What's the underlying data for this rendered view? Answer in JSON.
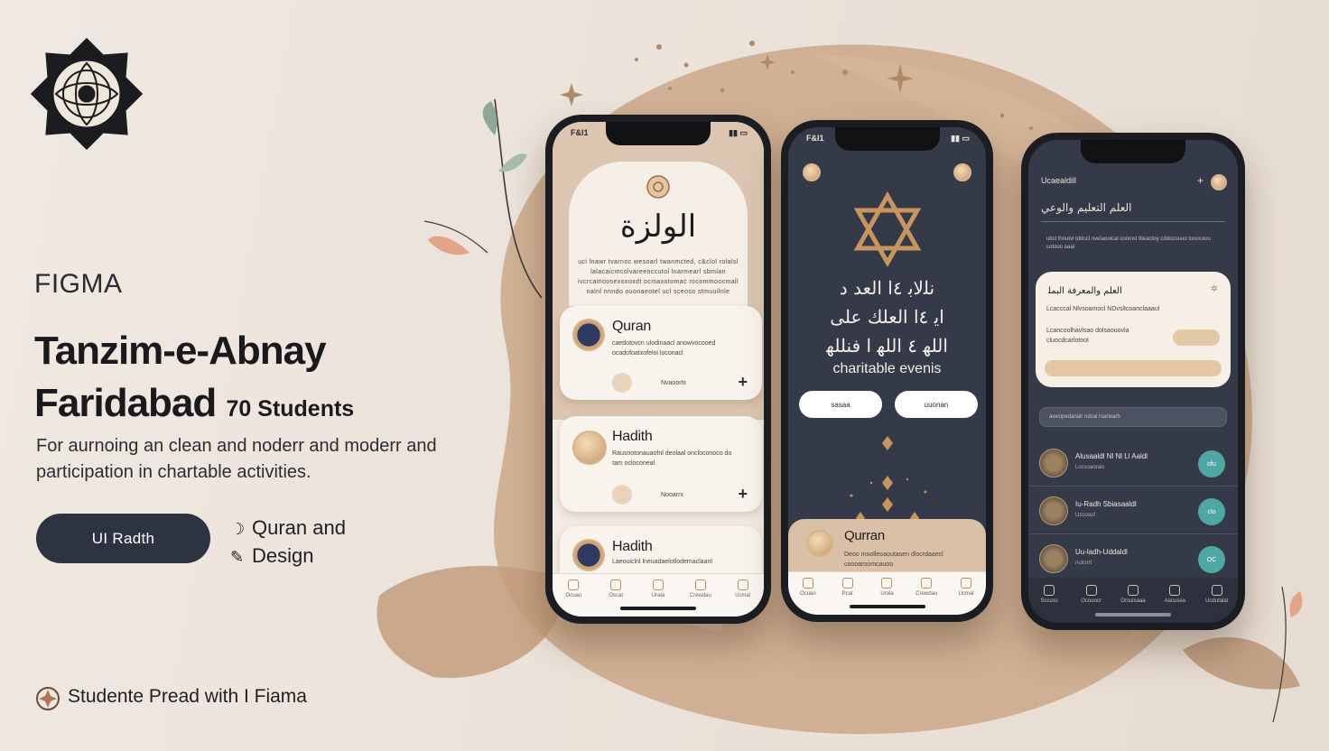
{
  "brand": {
    "tool_label": "FIGMA",
    "title_line1": "Tanzim-e-Abnay",
    "title_line2": "Faridabad",
    "students_count": "70 Students",
    "description": "For aurnoing an clean and noderr and moderr and participation in chartable activities.",
    "cta_label": "UI Radth",
    "side_notes": [
      "Quran and",
      "Design"
    ],
    "footer": "Studente Pread with I Fiama"
  },
  "colors": {
    "background": "#ebe2d9",
    "accent_tan": "#d8bfa5",
    "navy": "#2d3340",
    "teal_badge": "#4fa7a4"
  },
  "phone1": {
    "status_time": "F&l1",
    "hero_arabic": "الولزة",
    "hero_text": "uci lnawr tvarnoc wesoarl twanmcted, c&clol rolalsl lalacaicmcolvareenccutol lnarmearl sbmlan ivcrcamoosexoxoxdt ocmaxotomac rocommoocmall nalnl nnndo ouonaeotel ucl sceoso stmuuilnle",
    "cards": [
      {
        "title": "Quran",
        "sub": "caedotovcn ulodinaacl anowvocooed ocadofoatxofeloi loconacl",
        "meta": "Nvaoortx"
      },
      {
        "title": "Hadith",
        "sub": "Rausnotonauaofnl deolaal oncloconoco do tam ocloconeal",
        "meta": "Nooarrx"
      },
      {
        "title": "Hadith",
        "sub": "Laeouiclnl lneuadaelotlodemaclaanl",
        "meta": ""
      }
    ],
    "tabs": [
      "Ocuan",
      "Oscat",
      "Urala",
      "Crewdau",
      "Ucmal"
    ]
  },
  "phone2": {
    "status_time": "F&l1",
    "arabic_lines": [
      "ﻧﻠﻟﺎﺑ  ٤ﺍ  ﺍﻟﻌﺪ  ﺩ",
      "ﺍﯾ  ٤ﺍ  ﺍﻟﻌﻠﻚ  ﻋﻠﻰ",
      "ﺍﻟﻠﻬ  ٤  ﺍﻟﻠﻬ  ﺍ  ﻓﻨﻠﻠﻬ"
    ],
    "subtitle": "charitable evenis",
    "pill_left": "sasaa",
    "pill_right": "uuonan",
    "card_title": "Qurran",
    "card_sub": "Deoo moolleoaoutasen dlocrdaaecl coooaroomcauoo",
    "tabs": [
      "Ocuan",
      "Pcat",
      "Urala",
      "Crewdau",
      "Ucmal"
    ]
  },
  "phone3": {
    "header_small": "Ucaealdill",
    "header": "ﺍﻟﻌﻠﻢ ﺍﻟﺘﻌﻠﯿﻢ ﻭﺍﻟﻮﻋﻲ",
    "intro": "ubsl thnutvl tddocl nvelaoolcal conmsl tbeactoy cddocouuo looocoou cotooo aaal",
    "card_title": "ﺍﻟﻌﻠﻢ ﻭﺍﻟﻤﻌﺮﻓﺔ ﺍﻟﺒﻤﻠ",
    "card_lines": [
      "Lcacccal Nlvsoamocl NDvsltcoanclaaaul",
      "Lcancoolhavlsao dolsaouovla cluocdcarlotool"
    ],
    "search_placeholder": "awvopedarialr ndcal rsarlearh",
    "rows": [
      {
        "name": "Alusaaldl Nl Nl Ll Aaldl",
        "sub": "Locsoaorals",
        "badge": "ofu"
      },
      {
        "name": "Iu-Radh Sbiasaaldl",
        "sub": "Uzcoouf",
        "badge": "clo"
      },
      {
        "name": "Uu-ladh-Uddaldl",
        "sub": "nulcnrt",
        "badge": "OC"
      }
    ],
    "tabs": [
      "Sccuxs",
      "Ocouocr",
      "Orsuisaaa",
      "Aacusea",
      "Ucdutalat"
    ]
  }
}
